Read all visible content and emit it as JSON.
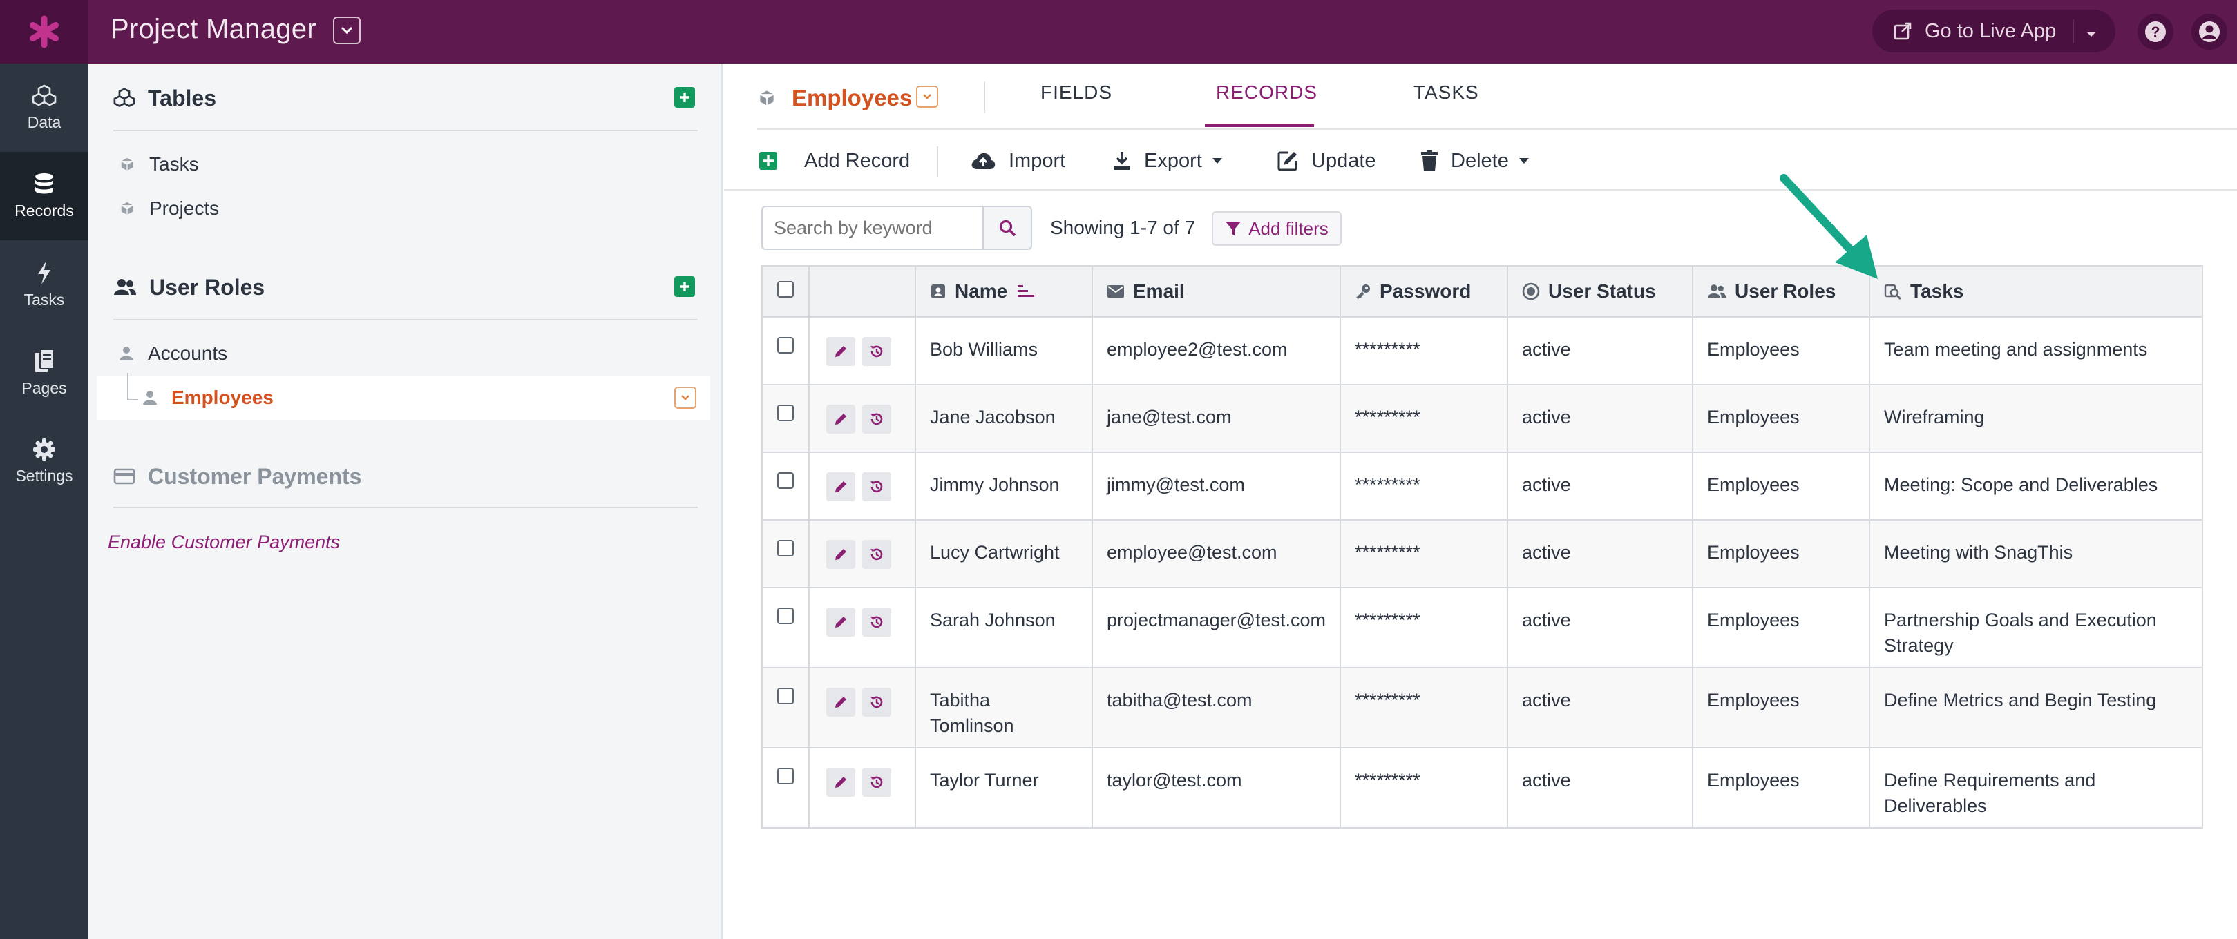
{
  "app": {
    "title": "Project Manager",
    "live_app_label": "Go to Live App"
  },
  "rail": {
    "items": [
      {
        "label": "Data",
        "icon": "cubes-icon"
      },
      {
        "label": "Records",
        "icon": "database-icon"
      },
      {
        "label": "Tasks",
        "icon": "bolt-icon"
      },
      {
        "label": "Pages",
        "icon": "pages-icon"
      },
      {
        "label": "Settings",
        "icon": "gear-icon"
      }
    ],
    "active": "Records"
  },
  "sidebar": {
    "tables_header": "Tables",
    "tables": [
      "Tasks",
      "Projects"
    ],
    "roles_header": "User Roles",
    "roles": [
      "Accounts",
      "Employees"
    ],
    "payments_header": "Customer Payments",
    "enable_payments": "Enable Customer Payments"
  },
  "object": {
    "title": "Employees",
    "tabs": [
      "FIELDS",
      "RECORDS",
      "TASKS"
    ],
    "active_tab": "RECORDS"
  },
  "toolbar": {
    "add_record": "Add Record",
    "import": "Import",
    "export": "Export",
    "update": "Update",
    "delete": "Delete"
  },
  "filter": {
    "search_placeholder": "Search by keyword",
    "showing": "Showing 1-7 of 7",
    "add_filters": "Add filters"
  },
  "table": {
    "columns": [
      "Name",
      "Email",
      "Password",
      "User Status",
      "User Roles",
      "Tasks"
    ],
    "rows": [
      {
        "name": "Bob Williams",
        "email": "employee2@test.com",
        "password": "*********",
        "status": "active",
        "roles": "Employees",
        "tasks": "Team meeting and assignments"
      },
      {
        "name": "Jane Jacobson",
        "email": "jane@test.com",
        "password": "*********",
        "status": "active",
        "roles": "Employees",
        "tasks": "Wireframing"
      },
      {
        "name": "Jimmy Johnson",
        "email": "jimmy@test.com",
        "password": "*********",
        "status": "active",
        "roles": "Employees",
        "tasks": "Meeting: Scope and Deliverables"
      },
      {
        "name": "Lucy Cartwright",
        "email": "employee@test.com",
        "password": "*********",
        "status": "active",
        "roles": "Employees",
        "tasks": "Meeting with SnagThis"
      },
      {
        "name": "Sarah Johnson",
        "email": "projectmanager@test.com",
        "password": "*********",
        "status": "active",
        "roles": "Employees",
        "tasks": "Partnership Goals and Execution Strategy"
      },
      {
        "name": "Tabitha Tomlinson",
        "email": "tabitha@test.com",
        "password": "*********",
        "status": "active",
        "roles": "Employees",
        "tasks": "Define Metrics and Begin Testing"
      },
      {
        "name": "Taylor Turner",
        "email": "taylor@test.com",
        "password": "*********",
        "status": "active",
        "roles": "Employees",
        "tasks": "Define Requirements and Deliverables"
      }
    ]
  },
  "colors": {
    "brand": "#5e1a4f",
    "accent": "#8b1f74",
    "object_title": "#d3521d",
    "add_green": "#129a5e",
    "annotation_arrow": "#17a88a"
  }
}
